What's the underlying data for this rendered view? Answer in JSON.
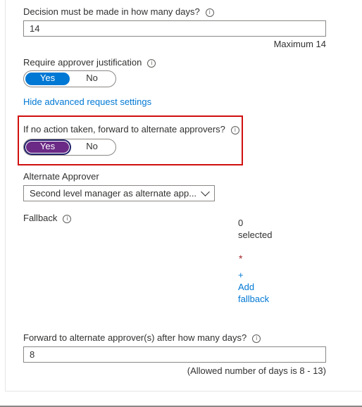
{
  "colors": {
    "accent_blue": "#0078d4",
    "accent_purple": "#6b2a86",
    "highlight_red": "#d10f0f",
    "required_red": "#a4262c"
  },
  "decision_days": {
    "label": "Decision must be made in how many days?",
    "value": "14",
    "hint": "Maximum 14"
  },
  "justification": {
    "label": "Require approver justification",
    "yes": "Yes",
    "no": "No",
    "selected": "Yes"
  },
  "advanced_link": "Hide advanced request settings",
  "forward": {
    "label": "If no action taken, forward to alternate approvers?",
    "yes": "Yes",
    "no": "No",
    "selected": "Yes"
  },
  "alternate_approver": {
    "label": "Alternate Approver",
    "value": "Second level manager as alternate app..."
  },
  "fallback": {
    "label": "Fallback",
    "count": "0",
    "count_suffix": "selected",
    "required_mark": "*",
    "add_plus": "+",
    "add_line1": "Add",
    "add_line2": "fallback"
  },
  "forward_days": {
    "label": "Forward to alternate approver(s) after how many days?",
    "value": "8",
    "hint": "(Allowed number of days is 8 - 13)"
  }
}
